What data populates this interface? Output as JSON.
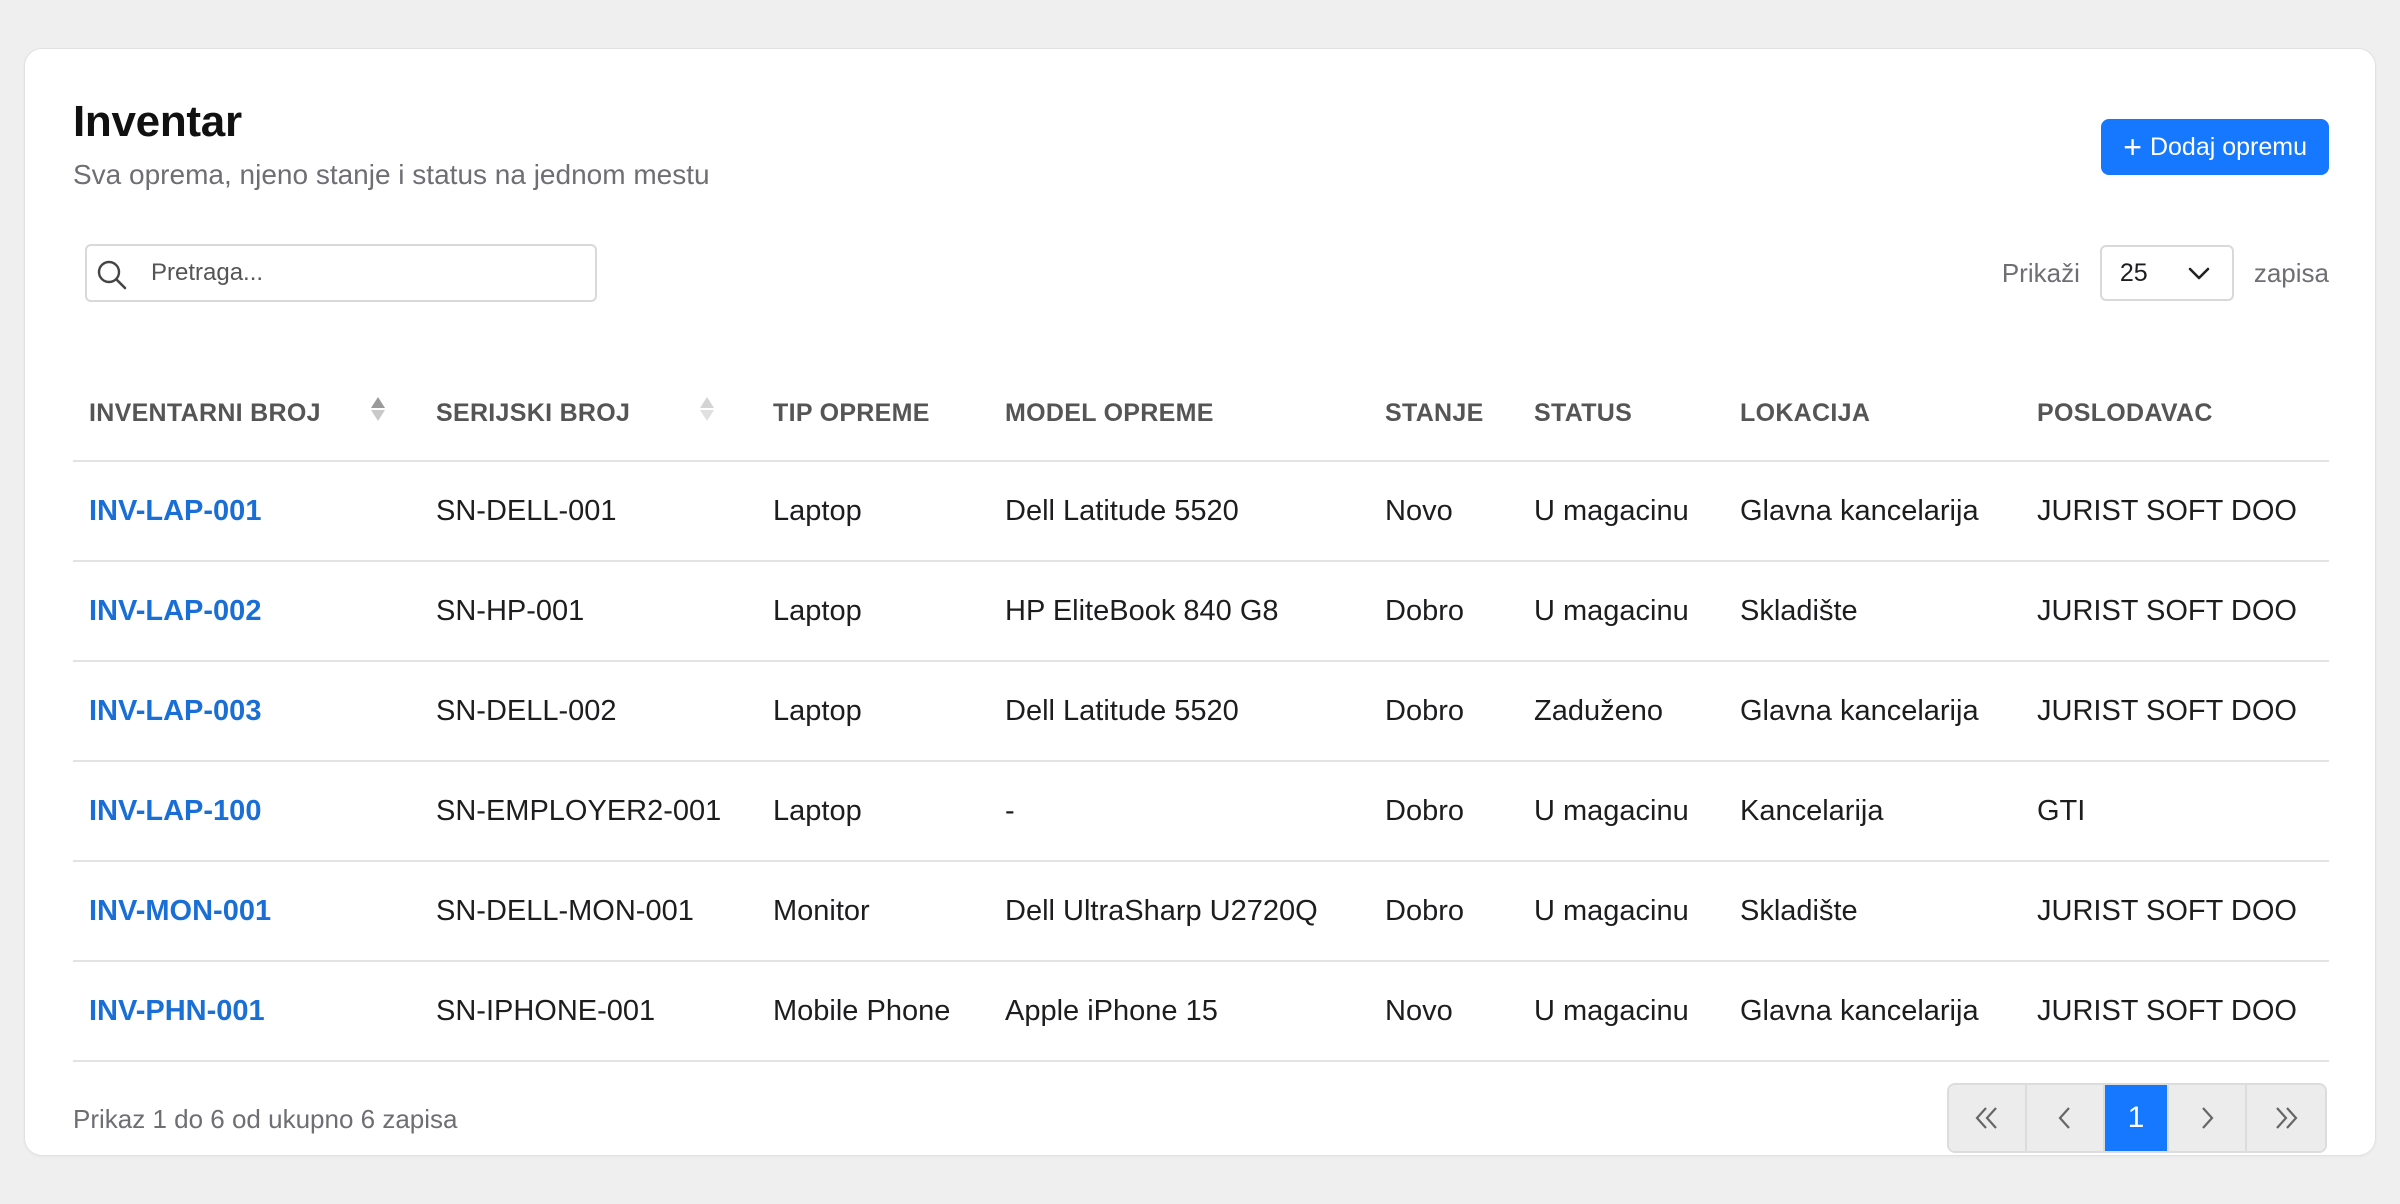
{
  "page": {
    "title": "Inventar",
    "subtitle": "Sva oprema, njeno stanje i status na jednom mestu",
    "add_button_label": "Dodaj opremu",
    "accent_color": "#1677ff",
    "link_color": "#1a6fd6"
  },
  "search": {
    "placeholder": "Pretraga...",
    "value": ""
  },
  "page_size": {
    "prefix": "Prikaži",
    "value": "25",
    "suffix": "zapisa"
  },
  "table": {
    "headers": {
      "inventory_number": "INVENTARNI BROJ",
      "serial_number": "SERIJSKI BROJ",
      "equipment_type": "TIP OPREME",
      "equipment_model": "MODEL OPREME",
      "condition": "STANJE",
      "status": "STATUS",
      "location": "LOKACIJA",
      "employer": "POSLODAVAC"
    },
    "rows": [
      {
        "inv": "INV-LAP-001",
        "serial": "SN-DELL-001",
        "type": "Laptop",
        "model": "Dell Latitude 5520",
        "condition": "Novo",
        "status": "U magacinu",
        "location": "Glavna kancelarija",
        "employer": "JURIST SOFT DOO"
      },
      {
        "inv": "INV-LAP-002",
        "serial": "SN-HP-001",
        "type": "Laptop",
        "model": "HP EliteBook 840 G8",
        "condition": "Dobro",
        "status": "U magacinu",
        "location": "Skladište",
        "employer": "JURIST SOFT DOO"
      },
      {
        "inv": "INV-LAP-003",
        "serial": "SN-DELL-002",
        "type": "Laptop",
        "model": "Dell Latitude 5520",
        "condition": "Dobro",
        "status": "Zaduženo",
        "location": "Glavna kancelarija",
        "employer": "JURIST SOFT DOO"
      },
      {
        "inv": "INV-LAP-100",
        "serial": "SN-EMPLOYER2-001",
        "type": "Laptop",
        "model": "-",
        "condition": "Dobro",
        "status": "U magacinu",
        "location": "Kancelarija",
        "employer": "GTI"
      },
      {
        "inv": "INV-MON-001",
        "serial": "SN-DELL-MON-001",
        "type": "Monitor",
        "model": "Dell UltraSharp U2720Q",
        "condition": "Dobro",
        "status": "U magacinu",
        "location": "Skladište",
        "employer": "JURIST SOFT DOO"
      },
      {
        "inv": "INV-PHN-001",
        "serial": "SN-IPHONE-001",
        "type": "Mobile Phone",
        "model": "Apple iPhone 15",
        "condition": "Novo",
        "status": "U magacinu",
        "location": "Glavna kancelarija",
        "employer": "JURIST SOFT DOO"
      }
    ]
  },
  "footer": {
    "info": "Prikaz 1 do 6 od ukupno 6 zapisa",
    "current_page": "1"
  }
}
